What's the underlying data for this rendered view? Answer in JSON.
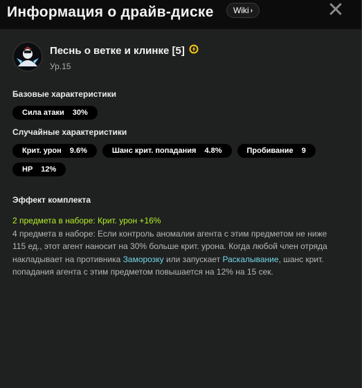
{
  "window": {
    "title": "Информация о драйв-диске",
    "wiki_label": "Wiki",
    "close_glyph": "✕"
  },
  "disc": {
    "name": "Песнь о ветке и клинке [5]",
    "level": "Ур.15",
    "avatar_icon": "character-avatar-icon",
    "attribute_icon": "electric-attribute-icon"
  },
  "base_stats": {
    "label": "Базовые характеристики",
    "items": [
      {
        "name": "Сила атаки",
        "value": "30%"
      }
    ]
  },
  "random_stats": {
    "label": "Случайные характеристики",
    "items": [
      {
        "name": "Крит. урон",
        "value": "9.6%"
      },
      {
        "name": "Шанс крит. попадания",
        "value": "4.8%"
      },
      {
        "name": "Пробивание",
        "value": "9"
      },
      {
        "name": "HP",
        "value": "12%"
      }
    ]
  },
  "set_effect": {
    "label": "Эффект комплекта",
    "two_piece": "2 предмета в наборе: Крит. урон +16%",
    "four_piece_part1": "4 предмета в наборе: Если контроль аномалии агента с этим предметом не ниже 115 ед., этот агент наносит на 30% больше крит. урона. Когда любой член отряда накладывает на противника ",
    "keyword_freeze": "Заморозку",
    "four_piece_part2": " или запускает ",
    "keyword_shatter": "Раскалывание",
    "four_piece_part3": ", шанс крит. попадания агента с этим предметом повышается на 12% на 15 сек."
  },
  "colors": {
    "background": "#1f2020",
    "topbar": "#0c0c0c",
    "chip": "#000000",
    "two_piece_green": "#b6f12a",
    "keyword_cyan": "#74d8e9",
    "attribute_yellow": "#f3c81a"
  }
}
